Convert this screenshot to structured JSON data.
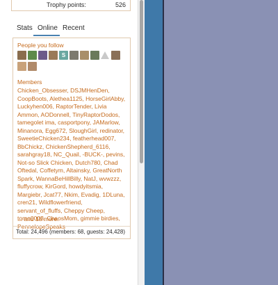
{
  "trophy": {
    "label": "Trophy points:",
    "value": "526"
  },
  "tabs": [
    {
      "label": "Stats"
    },
    {
      "label": "Online"
    },
    {
      "label": "Recent"
    }
  ],
  "follow": {
    "heading": "People you follow",
    "avatars": [
      {
        "name": "avatar-1",
        "color": "#8a6d4d"
      },
      {
        "name": "avatar-2",
        "color": "#5d8a4a"
      },
      {
        "name": "avatar-3",
        "color": "#6d5a8a"
      },
      {
        "name": "avatar-4",
        "color": "#9a7a58"
      },
      {
        "name": "avatar-5",
        "color": "#6aa7a0",
        "letter": "S"
      },
      {
        "name": "avatar-6",
        "color": "#7d7a6e"
      },
      {
        "name": "avatar-7",
        "color": "#a98f6a"
      },
      {
        "name": "avatar-8",
        "color": "#6a7a5a"
      },
      {
        "name": "avatar-9",
        "color": "#c9c9c9"
      },
      {
        "name": "avatar-10",
        "color": "#8a7058"
      },
      {
        "name": "avatar-11",
        "color": "#c9a27a"
      },
      {
        "name": "avatar-12",
        "color": "#b08a6a"
      }
    ]
  },
  "members": {
    "heading": "Members",
    "list": "Chicken_Obsesser, DSJMHenDen, CoopBoots, Alethea1125, HorseGirlAbby, Luckyhen006, RaptorTender, Livia Ammon, AODonnell, TinyRaptorDodos, tamegolet ima, casportpony, JAMarlow, Minanora, Egg672, SloughGirl, redinator, SweetieChicken234, featherhead007, BbChickz, ChickenShepherd_6116, sarahgray18, NC_Quail, -BUCK-, pevins, Not-so Slick Chicken, Dutch780, Chad Oftedal, Coffetym, Altainsky, GreatNorth Spark, WannaBeHillBilly, NatJ, wvwzzz, fluffycrow, KirGord, howdyitsmia, Margiebr, Jcat77, Nkim, Evadig, 1DLuna, cren21, Wildflowerfriend, servant_of_fluffs, Cheppy Cheep, tomo0003, ChaosMom, gimmie birdies, PennelopeSpeaks",
    "more": "... and 18 more.",
    "total": "Total: 24,496 (members: 68, guests: 24,428)"
  }
}
